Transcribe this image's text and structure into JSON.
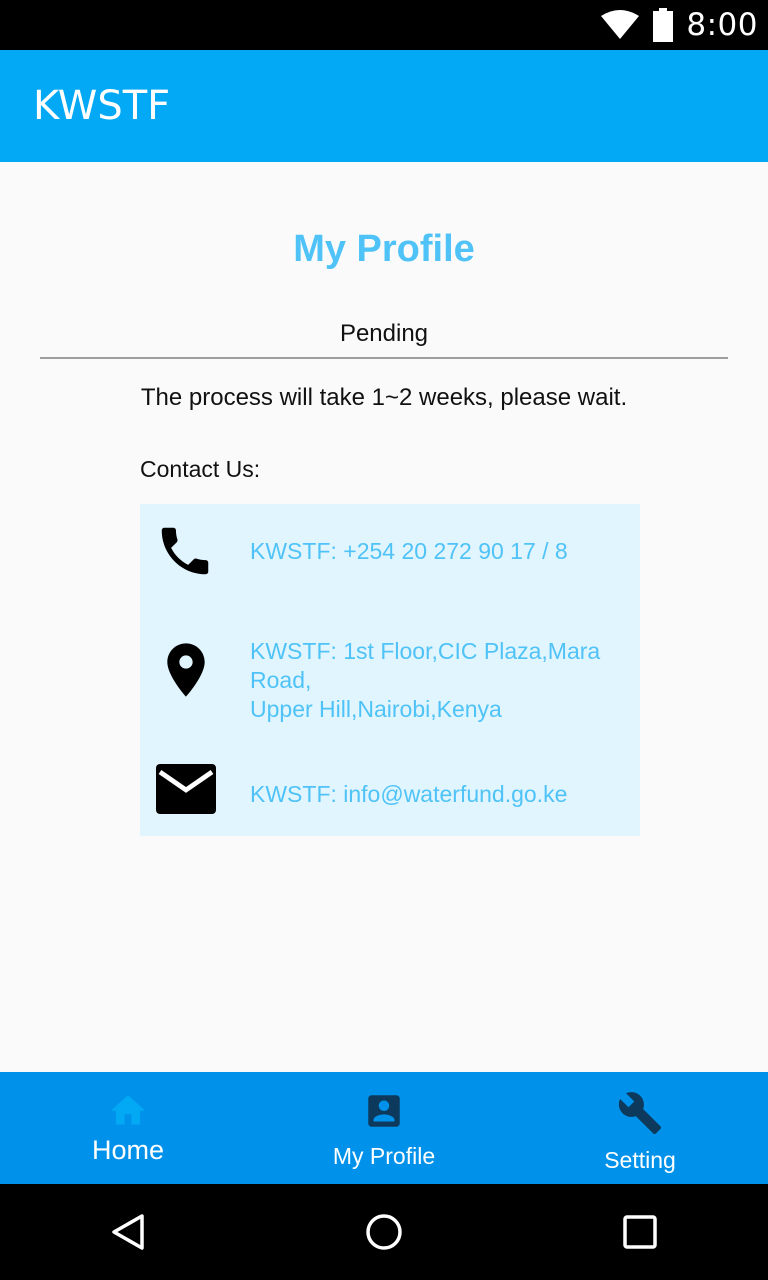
{
  "status_bar": {
    "time": "8:00"
  },
  "app_bar": {
    "title": "KWSTF"
  },
  "profile": {
    "title": "My Profile",
    "status": "Pending",
    "message": "The process will take 1~2 weeks, please wait."
  },
  "contact": {
    "heading": "Contact Us:",
    "phone": "KWSTF: +254 20 272 90 17 / 8",
    "address_line1": "KWSTF: 1st Floor,CIC Plaza,Mara",
    "address_line2": "Road,",
    "address_line3": "Upper Hill,Nairobi,Kenya",
    "email": "KWSTF: info@waterfund.go.ke"
  },
  "bottom_nav": {
    "items": [
      {
        "label": "Home",
        "icon": "home-icon",
        "active": true
      },
      {
        "label": "My Profile",
        "icon": "account-box-icon",
        "active": false
      },
      {
        "label": "Setting",
        "icon": "wrench-icon",
        "active": false
      }
    ]
  },
  "colors": {
    "app_bar": "#03a9f4",
    "bottom_nav": "#0091ea",
    "accent_text": "#4fc3f7",
    "contact_bg": "#e1f5fe",
    "active_nav_icon": "#03a9f4",
    "inactive_nav_icon": "#0d3a5c"
  }
}
